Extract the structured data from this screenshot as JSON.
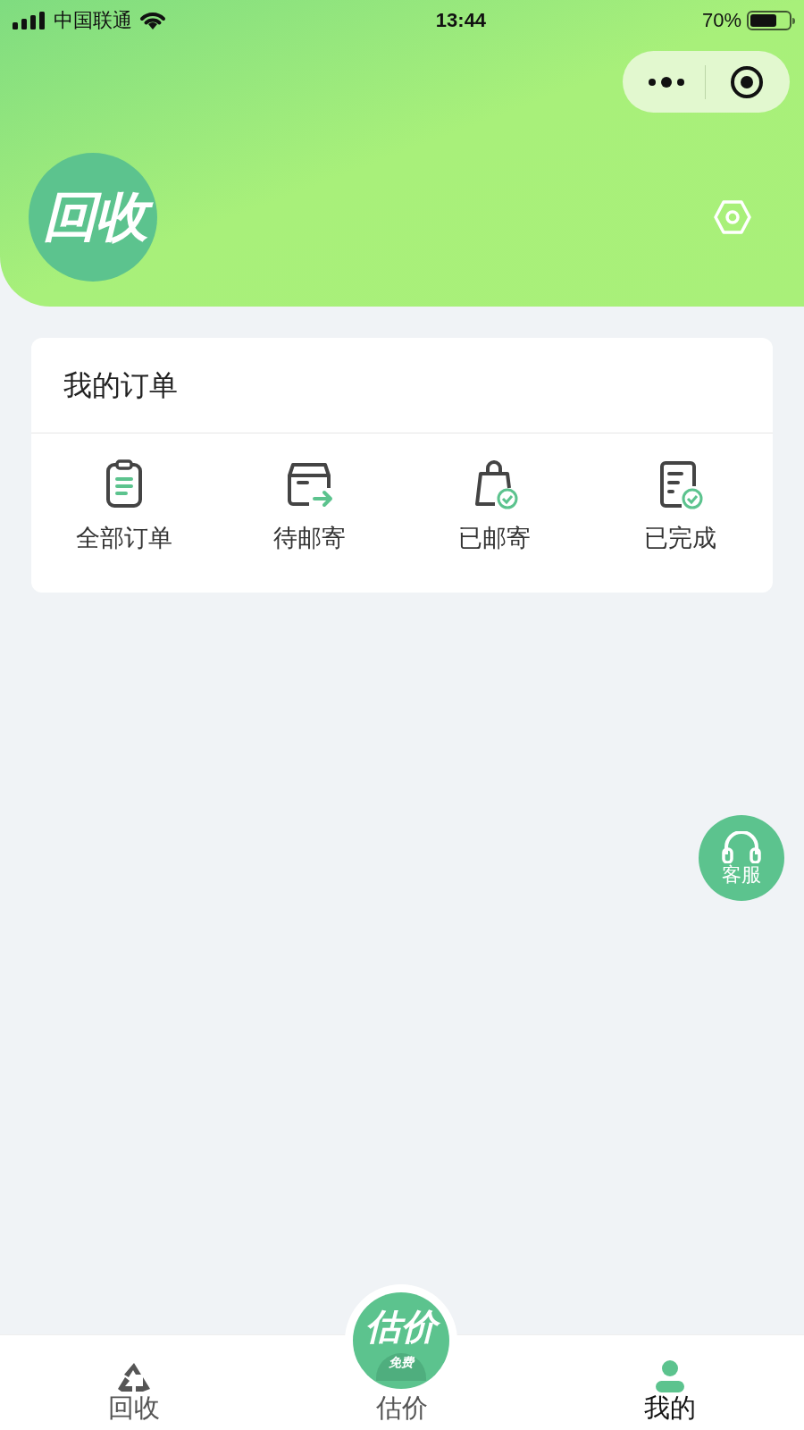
{
  "status_bar": {
    "carrier": "中国联通",
    "time": "13:44",
    "battery": "70%"
  },
  "header": {
    "logo_text": "回收"
  },
  "orders": {
    "title": "我的订单",
    "items": [
      {
        "kind": "clipboard",
        "label": "全部订单"
      },
      {
        "kind": "box",
        "label": "待邮寄"
      },
      {
        "kind": "bag",
        "label": "已邮寄"
      },
      {
        "kind": "doc",
        "label": "已完成"
      }
    ]
  },
  "service_button": {
    "label": "客服"
  },
  "center_button": {
    "title": "估价",
    "badge": "免费"
  },
  "tabs": [
    {
      "kind": "recycle",
      "label": "回收",
      "selected": false
    },
    {
      "kind": "none",
      "label": "估价",
      "selected": false
    },
    {
      "kind": "user",
      "label": "我的",
      "selected": true
    }
  ]
}
